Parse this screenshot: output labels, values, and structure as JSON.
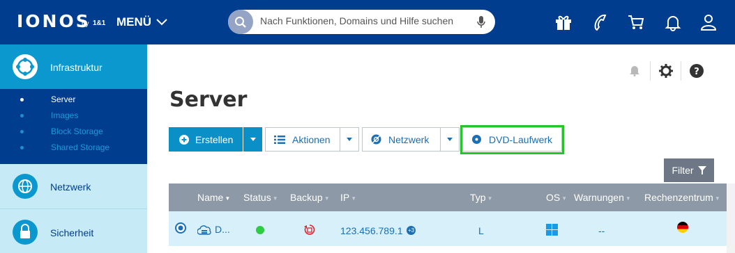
{
  "header": {
    "logo": "IONOS",
    "logo_by": "by",
    "logo_brand": "1&1",
    "menu_label": "MENÜ",
    "search_placeholder": "Nach Funktionen, Domains und Hilfe suchen",
    "icons": [
      "gift-icon",
      "phone-icon",
      "cart-icon",
      "bell-icon",
      "user-icon"
    ]
  },
  "sidebar": {
    "items": [
      {
        "label": "Infrastruktur",
        "icon": "infrastructure-icon",
        "active": true
      },
      {
        "label": "Netzwerk",
        "icon": "network-globe-icon"
      },
      {
        "label": "Sicherheit",
        "icon": "lock-icon"
      }
    ],
    "subitems": [
      {
        "label": "Server",
        "active": true
      },
      {
        "label": "Images"
      },
      {
        "label": "Block Storage"
      },
      {
        "label": "Shared Storage"
      }
    ]
  },
  "main": {
    "title": "Server",
    "toolbar": {
      "create": "Erstellen",
      "actions": "Aktionen",
      "network": "Netzwerk",
      "dvd": "DVD-Laufwerk"
    },
    "filter": "Filter",
    "table": {
      "columns": [
        "Name",
        "Status",
        "Backup",
        "IP",
        "Typ",
        "OS",
        "Warnungen",
        "Rechenzentrum"
      ],
      "rows": [
        {
          "name": "D...",
          "status": "online",
          "ip": "123.456.789.1",
          "ip_extra": "+3",
          "type": "L",
          "os": "windows",
          "warnings": "--",
          "datacenter": "germany-flag"
        }
      ]
    }
  },
  "colors": {
    "header_bg": "#003d8f",
    "accent": "#0b98cf",
    "highlight": "#29c12c",
    "status_online": "#2ecc40"
  }
}
